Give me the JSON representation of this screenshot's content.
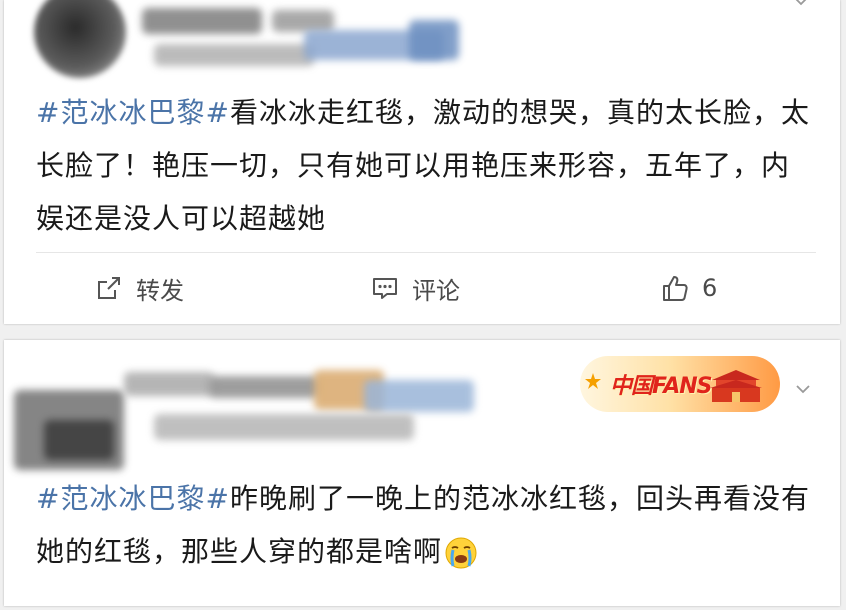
{
  "posts": [
    {
      "hashtag": "#范冰冰巴黎#",
      "text": "看冰冰走红毯，激动的想哭，真的太长脸，太长脸了！艳压一切，只有她可以用艳压来形容，五年了，内娱还是没人可以超越她",
      "actions": {
        "repost_label": "转发",
        "comment_label": "评论",
        "like_count": "6"
      }
    },
    {
      "hashtag": "#范冰冰巴黎#",
      "text": "昨晚刷了一晚上的范冰冰红毯，回头再看没有她的红毯，那些人穿的都是啥啊",
      "emoji": "crying-face",
      "badge_text": "中国FANS"
    }
  ],
  "colors": {
    "hashtag": "#4b74a8",
    "body_text": "#1a1a1a",
    "action_text": "#4a4a4a",
    "badge_red": "#e0241b",
    "page_bg": "#f0f0f0"
  },
  "icons": {
    "repost": "share-arrow-icon",
    "comment": "comment-bubble-icon",
    "like": "thumbs-up-icon",
    "menu": "chevron-down-icon"
  }
}
